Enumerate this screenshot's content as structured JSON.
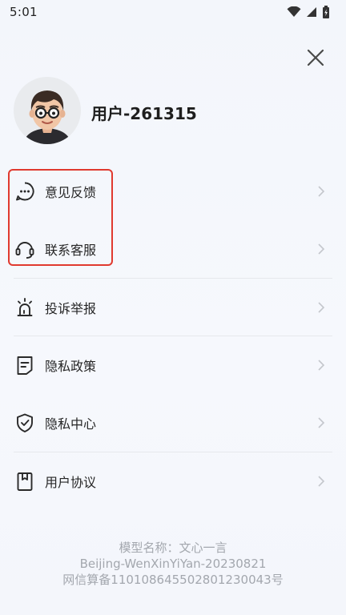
{
  "status_bar": {
    "time": "5:01",
    "icons": [
      "wifi-icon",
      "signal-icon",
      "battery-icon"
    ]
  },
  "header": {
    "close_icon": "close-icon"
  },
  "profile": {
    "username": "用户-261315",
    "avatar": "avatar-cartoon-man-glasses"
  },
  "menu": {
    "feedback": "意见反馈",
    "customer_service": "联系客服",
    "complaint": "投诉举报",
    "privacy_policy": "隐私政策",
    "privacy_center": "隐私中心",
    "user_agreement": "用户协议"
  },
  "footer": {
    "model_name": "模型名称：文心一言",
    "model_id": "Beijing-WenXinYiYan-20230821",
    "filing": "网信算备110108645502801230043号"
  },
  "colors": {
    "highlight": "#e03a2f",
    "text": "#262626",
    "footer_text": "#a3a7ae"
  }
}
